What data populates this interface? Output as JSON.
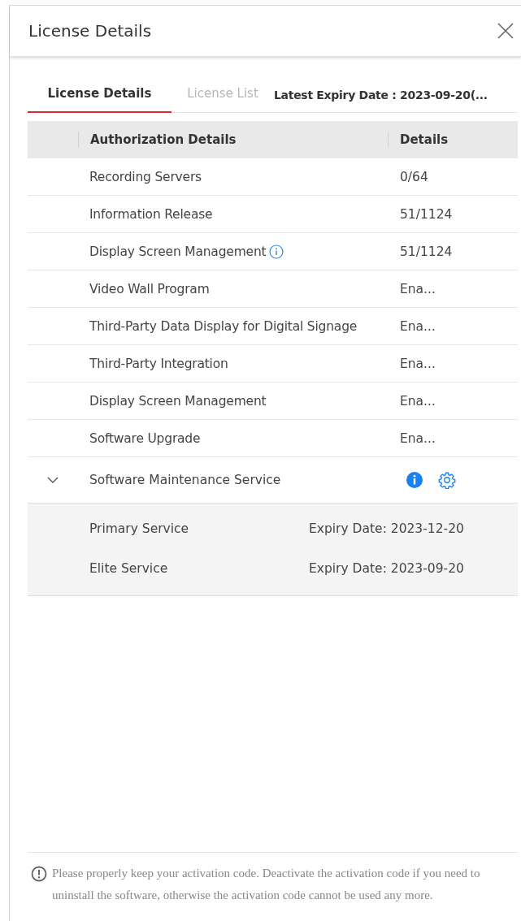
{
  "window": {
    "title": "License Details"
  },
  "tabs": [
    {
      "label": "License Details",
      "selected": true
    },
    {
      "label": "License List",
      "selected": false
    }
  ],
  "latest_expiry": "Latest Expiry Date : 2023-09-20(...",
  "table": {
    "columns": [
      "Authorization Details",
      "Details"
    ],
    "rows": [
      {
        "kind": "plain",
        "name": "Recording Servers",
        "details": "0/64"
      },
      {
        "kind": "plain",
        "name": "Information Release",
        "details": "51/1124"
      },
      {
        "kind": "info",
        "name": "Display Screen Management",
        "details": "51/1124"
      },
      {
        "kind": "plain",
        "name": "Video Wall Program",
        "details": "Ena..."
      },
      {
        "kind": "plain",
        "name": "Third-Party Data Display for Digital Signage",
        "details": "Ena..."
      },
      {
        "kind": "plain",
        "name": "Third-Party Integration",
        "details": "Ena..."
      },
      {
        "kind": "plain",
        "name": "Display Screen Management",
        "details": "Ena..."
      },
      {
        "kind": "plain",
        "name": "Software Upgrade",
        "details": "Ena..."
      },
      {
        "kind": "group",
        "name": "Software Maintenance Service",
        "expanded": true,
        "children": [
          {
            "name": "Primary Service",
            "details": "Expiry Date: 2023-12-20"
          },
          {
            "name": "Elite Service",
            "details": "Expiry Date: 2023-09-20"
          }
        ]
      }
    ]
  },
  "note": "Please properly keep your activation code. Deactivate the activation code if you need to uninstall the software, otherwise the activation code cannot be used any more."
}
